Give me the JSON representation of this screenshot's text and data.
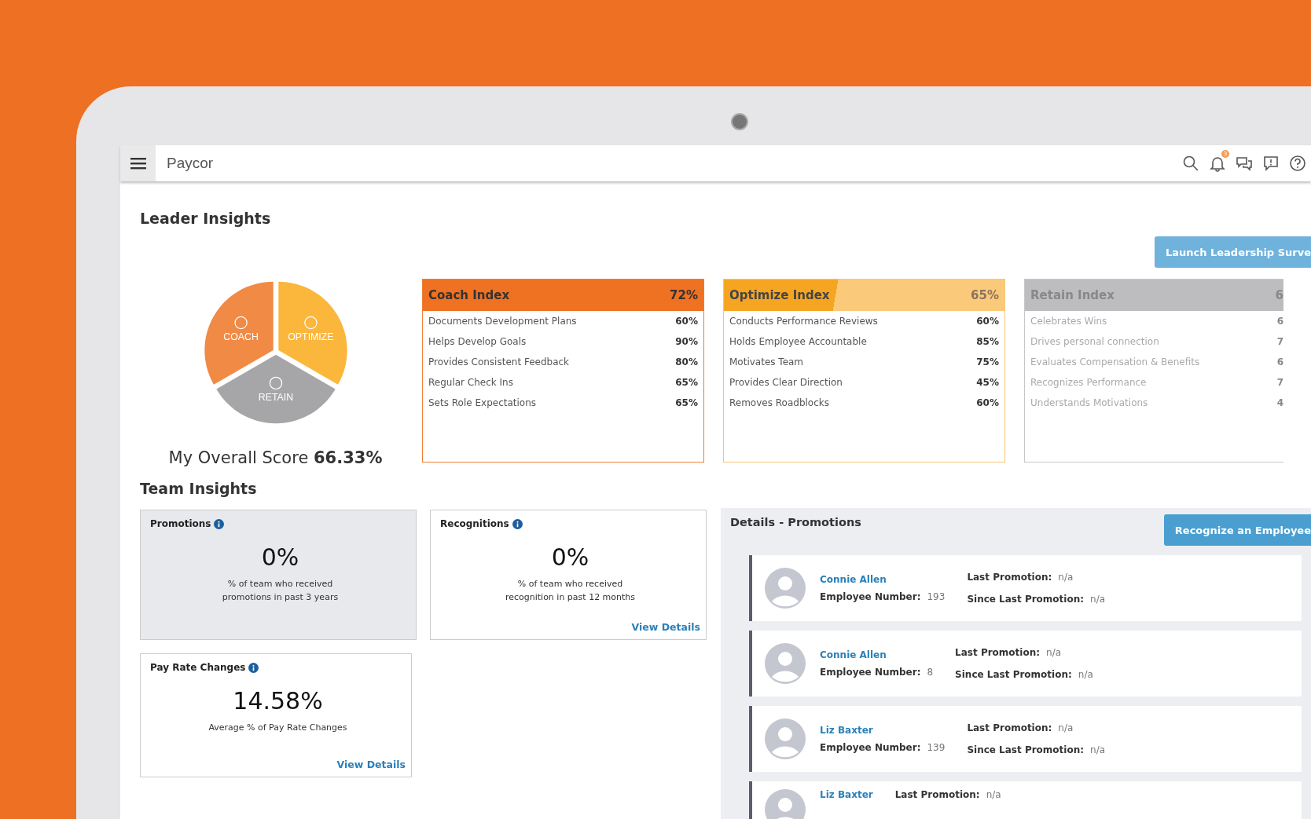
{
  "header": {
    "logo": "Paycor",
    "notification_count": "3"
  },
  "leader_insights": {
    "title": "Leader Insights",
    "launch_button": "Launch Leadership Surve",
    "wheel": [
      {
        "kind": "coach",
        "label": "COACH",
        "color": "#f08a45"
      },
      {
        "kind": "optimize",
        "label": "OPTIMIZE",
        "color": "#fbb63c"
      },
      {
        "kind": "retain",
        "label": "RETAIN",
        "color": "#a6a6a8"
      }
    ],
    "overall_score": "My Overall Score **66.33%**",
    "indices": [
      {
        "kind": "coach",
        "title": "Coach Index",
        "score": "72%",
        "items": [
          {
            "label": "Documents Development Plans",
            "value": "60%"
          },
          {
            "label": "Helps Develop Goals",
            "value": "90%"
          },
          {
            "label": "Provides Consistent Feedback",
            "value": "80%"
          },
          {
            "label": "Regular Check Ins",
            "value": "65%"
          },
          {
            "label": "Sets Role Expectations",
            "value": "65%"
          }
        ]
      },
      {
        "kind": "optimize",
        "title": "Optimize Index",
        "score": "65%",
        "items": [
          {
            "label": "Conducts Performance Reviews",
            "value": "60%"
          },
          {
            "label": "Holds Employee Accountable",
            "value": "85%"
          },
          {
            "label": "Motivates Team",
            "value": "75%"
          },
          {
            "label": "Provides Clear Direction",
            "value": "45%"
          },
          {
            "label": "Removes Roadblocks",
            "value": "60%"
          }
        ]
      },
      {
        "kind": "retain",
        "title": "Retain Index",
        "score": "6",
        "items": [
          {
            "label": "Celebrates Wins",
            "value": "6"
          },
          {
            "label": "Drives personal connection",
            "value": "7"
          },
          {
            "label": "Evaluates Compensation & Benefits",
            "value": "6"
          },
          {
            "label": "Recognizes Performance",
            "value": "7"
          },
          {
            "label": "Understands Motivations",
            "value": "4"
          }
        ]
      }
    ]
  },
  "team_insights": {
    "title": "Team Insights",
    "cards": [
      {
        "title": "Promotions",
        "value": "0%",
        "caption": "% of team who received promotions in past 3 years",
        "selected": true
      },
      {
        "title": "Recognitions",
        "value": "0%",
        "caption": "% of team who received recognition in past 12 months",
        "link": "View Details",
        "selected": false
      },
      {
        "title": "Pay Rate Changes",
        "value": "14.58%",
        "caption": "Average % of Pay Rate Changes",
        "link": "View Details",
        "selected": false
      }
    ]
  },
  "details": {
    "title": "Details - Promotions",
    "button": "Recognize an Employee",
    "employees": [
      {
        "name": "Connie Allen",
        "number_label": "Employee Number:",
        "number": "193",
        "last_label": "Last Promotion:",
        "last": "n/a",
        "since_label": "Since Last Promotion:",
        "since": "n/a"
      },
      {
        "name": "Connie Allen",
        "number_label": "Employee Number:",
        "number": "8",
        "last_label": "Last Promotion:",
        "last": "n/a",
        "since_label": "Since Last Promotion:",
        "since": "n/a"
      },
      {
        "name": "Liz Baxter",
        "number_label": "Employee Number:",
        "number": "139",
        "last_label": "Last Promotion:",
        "last": "n/a",
        "since_label": "Since Last Promotion:",
        "since": "n/a"
      },
      {
        "name": "Liz Baxter",
        "last_label": "Last Promotion:",
        "last": "n/a"
      }
    ]
  }
}
